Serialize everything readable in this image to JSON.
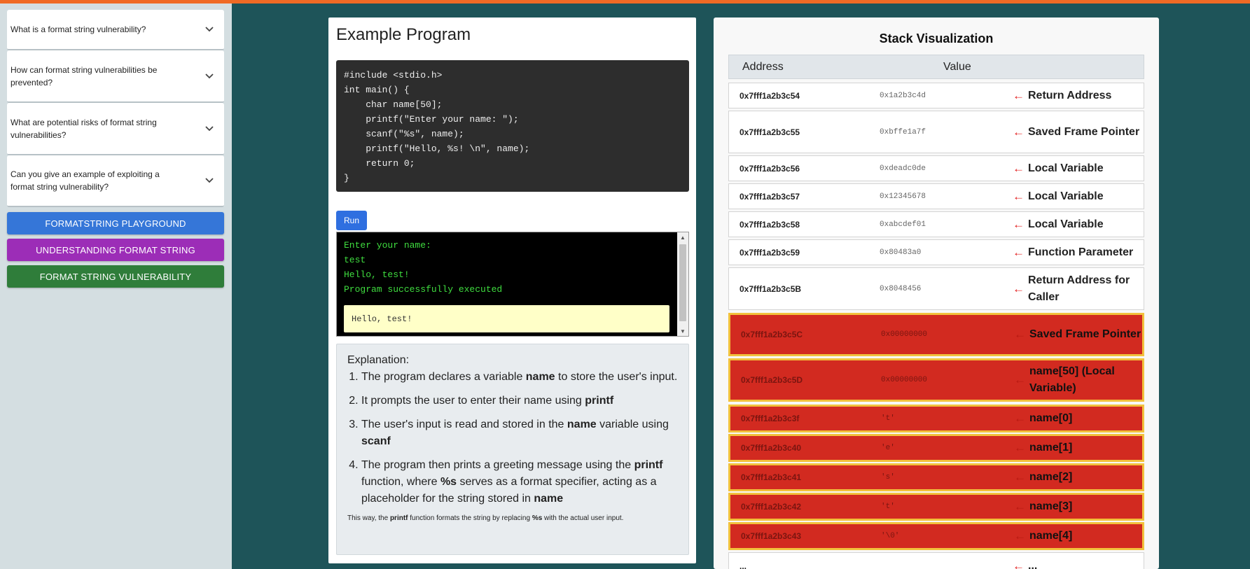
{
  "accent_color": "#f06a25",
  "faqs": [
    {
      "question": "What is a format string vulnerability?",
      "icon": "chevron-down-icon"
    },
    {
      "question": "How can format string vulnerabilities be prevented?",
      "icon": "chevron-down-icon"
    },
    {
      "question": "What are potential risks of format string vulnerabilities?",
      "icon": "chevron-down-icon"
    },
    {
      "question": "Can you give an example of exploiting a format string vulnerability?",
      "icon": "chevron-down-icon"
    }
  ],
  "nav_buttons": [
    {
      "label": "FORMATSTRING PLAYGROUND",
      "color": "#3576d8"
    },
    {
      "label": "UNDERSTANDING FORMAT STRING",
      "color": "#9c2db7"
    },
    {
      "label": "FORMAT STRING VULNERABILITY",
      "color": "#2f7d3a"
    }
  ],
  "program": {
    "title": "Example Program",
    "code": "#include <stdio.h>\nint main() {\n    char name[50];\n    printf(\"Enter your name: \");\n    scanf(\"%s\", name);\n    printf(\"Hello, %s! \\n\", name);\n    return 0;\n}",
    "run_label": "Run"
  },
  "console": {
    "lines": [
      "Enter your name:",
      "test",
      "Hello, test!",
      "Program successfully executed"
    ],
    "output": "Hello, test!"
  },
  "explanation": {
    "heading": "Explanation:",
    "items": [
      [
        "The program declares a variable ",
        "name",
        " to store the user's input."
      ],
      [
        "It prompts the user to enter their name using ",
        "printf",
        ""
      ],
      [
        "The user's input is read and stored in the ",
        "name",
        " variable using ",
        "scanf",
        ""
      ],
      [
        "The program then prints a greeting message using the ",
        "printf",
        " function, where ",
        "%s",
        " serves as a format specifier, acting as a placeholder for the string stored in ",
        "name",
        ""
      ]
    ],
    "note": [
      "This way, the ",
      "printf",
      " function formats the string by replacing ",
      "%s",
      " with the actual user input."
    ]
  },
  "stack": {
    "title": "Stack Visualization",
    "col_address": "Address",
    "col_value": "Value",
    "arrow": "←",
    "rows": [
      {
        "address": "0x7fff1a2b3c54",
        "value": "0x1a2b3c4d",
        "label": "Return Address",
        "highlight": false
      },
      {
        "address": "0x7fff1a2b3c55",
        "value": "0xbffe1a7f",
        "label": "Saved Frame Pointer",
        "highlight": false
      },
      {
        "address": "0x7fff1a2b3c56",
        "value": "0xdeadc0de",
        "label": "Local Variable",
        "highlight": false
      },
      {
        "address": "0x7fff1a2b3c57",
        "value": "0x12345678",
        "label": "Local Variable",
        "highlight": false
      },
      {
        "address": "0x7fff1a2b3c58",
        "value": "0xabcdef01",
        "label": "Local Variable",
        "highlight": false
      },
      {
        "address": "0x7fff1a2b3c59",
        "value": "0x80483a0",
        "label": "Function Parameter",
        "highlight": false
      },
      {
        "address": "0x7fff1a2b3c5B",
        "value": "0x8048456",
        "label": "Return Address for Caller",
        "highlight": false
      },
      {
        "address": "0x7fff1a2b3c5C",
        "value": "0x00000000",
        "label": "Saved Frame Pointer",
        "highlight": true
      },
      {
        "address": "0x7fff1a2b3c5D",
        "value": "0x00000000",
        "label": "name[50] (Local Variable)",
        "highlight": true
      },
      {
        "address": "0x7fff1a2b3c3f",
        "value": "'t'",
        "label": "name[0]",
        "highlight": true
      },
      {
        "address": "0x7fff1a2b3c40",
        "value": "'e'",
        "label": "name[1]",
        "highlight": true
      },
      {
        "address": "0x7fff1a2b3c41",
        "value": "'s'",
        "label": "name[2]",
        "highlight": true
      },
      {
        "address": "0x7fff1a2b3c42",
        "value": "'t'",
        "label": "name[3]",
        "highlight": true
      },
      {
        "address": "0x7fff1a2b3c43",
        "value": "'\\0'",
        "label": "name[4]",
        "highlight": true
      },
      {
        "address": "...",
        "value": "",
        "label": "...",
        "highlight": false
      }
    ]
  }
}
